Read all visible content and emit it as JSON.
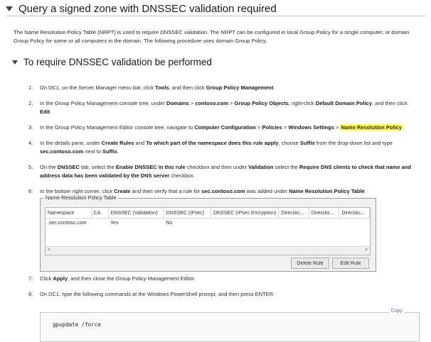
{
  "section": {
    "title": "Query a signed zone with DNSSEC validation required",
    "intro": "The Name Resolution Policy Table (NRPT) is used to require DNSSEC validation. The NRPT can be configured in local Group Policy for a single computer, or domain Group Policy for some or all computers in the domain. The following procedure uses domain Group Policy."
  },
  "subsection": {
    "title": "To require DNSSEC validation be performed"
  },
  "steps": [
    {
      "num": "1.",
      "parts": [
        {
          "t": "On DC1, on the Server Manager menu bar, click "
        },
        {
          "t": "Tools",
          "b": true
        },
        {
          "t": ", and then click "
        },
        {
          "t": "Group Policy Management",
          "b": true
        },
        {
          "t": "."
        }
      ]
    },
    {
      "num": "2.",
      "parts": [
        {
          "t": "In the Group Policy Management console tree, under "
        },
        {
          "t": "Domains",
          "b": true
        },
        {
          "t": " > "
        },
        {
          "t": "contoso.com",
          "b": true
        },
        {
          "t": " > "
        },
        {
          "t": "Group Policy Objects",
          "b": true
        },
        {
          "t": ", right-click "
        },
        {
          "t": "Default Domain Policy",
          "b": true
        },
        {
          "t": ", and then click "
        },
        {
          "t": "Edit",
          "b": true
        },
        {
          "t": "."
        }
      ]
    },
    {
      "num": "3.",
      "parts": [
        {
          "t": "In the Group Policy Management Editor console tree, navigate to "
        },
        {
          "t": "Computer Configuration",
          "b": true
        },
        {
          "t": " > "
        },
        {
          "t": "Policies",
          "b": true
        },
        {
          "t": " > "
        },
        {
          "t": "Windows Settings",
          "b": true
        },
        {
          "t": " > "
        },
        {
          "t": "Name Resolution Policy",
          "hl": true
        },
        {
          "t": "."
        }
      ]
    },
    {
      "num": "4.",
      "parts": [
        {
          "t": "In the details pane, under "
        },
        {
          "t": "Create Rules",
          "b": true
        },
        {
          "t": " and "
        },
        {
          "t": "To which part of the namespace does this rule apply",
          "b": true
        },
        {
          "t": ", choose "
        },
        {
          "t": "Suffix",
          "b": true
        },
        {
          "t": " from the drop-down list and type "
        },
        {
          "t": "sec.contoso.com",
          "b": true
        },
        {
          "t": " next to "
        },
        {
          "t": "Suffix",
          "b": true
        },
        {
          "t": "."
        }
      ]
    },
    {
      "num": "5.",
      "parts": [
        {
          "t": "On the "
        },
        {
          "t": "DNSSEC",
          "b": true
        },
        {
          "t": " tab, select the "
        },
        {
          "t": "Enable DNSSEC in this rule",
          "b": true
        },
        {
          "t": " checkbox and then under "
        },
        {
          "t": "Validation",
          "b": true
        },
        {
          "t": " select the "
        },
        {
          "t": "Require DNS clients to check that name and address data has been validated by the DNS server",
          "b": true
        },
        {
          "t": " checkbox."
        }
      ]
    },
    {
      "num": "6.",
      "parts": [
        {
          "t": "In the bottom right corner, click "
        },
        {
          "t": "Create",
          "b": true
        },
        {
          "t": " and then verify that a rule for "
        },
        {
          "t": "sec.contoso.com",
          "b": true
        },
        {
          "t": " was added under "
        },
        {
          "t": "Name Resolution Policy Table",
          "b": true
        },
        {
          "t": "."
        }
      ]
    },
    {
      "num": "7.",
      "parts": [
        {
          "t": "Click "
        },
        {
          "t": "Apply",
          "b": true
        },
        {
          "t": ", and then close the Group Policy Management Editor."
        }
      ]
    },
    {
      "num": "8.",
      "parts": [
        {
          "t": "On DC1, type the following commands at the Windows PowerShell prompt, and then press ENTER:"
        }
      ]
    }
  ],
  "nrpt": {
    "title": "Name Resolution Policy Table",
    "columns": [
      "Namespace",
      "CA",
      "DNSSEC (Validation)",
      "DNSSEC (IPsec)",
      "DNSSEC (IPsec Encryption)",
      "DirectAc...",
      "DirectAc...",
      "DirectAc..."
    ],
    "rows": [
      [
        ".sec.contoso.com",
        "",
        "Yes",
        "No",
        "",
        "",
        "",
        ""
      ]
    ],
    "scroll_left": "<",
    "scroll_right": ">",
    "delete_label": "Delete Rule",
    "edit_label": "Edit Rule"
  },
  "code": {
    "copy_label": "Copy",
    "command": "gpupdate /force"
  },
  "colors": {
    "highlight": "#ffff44"
  }
}
